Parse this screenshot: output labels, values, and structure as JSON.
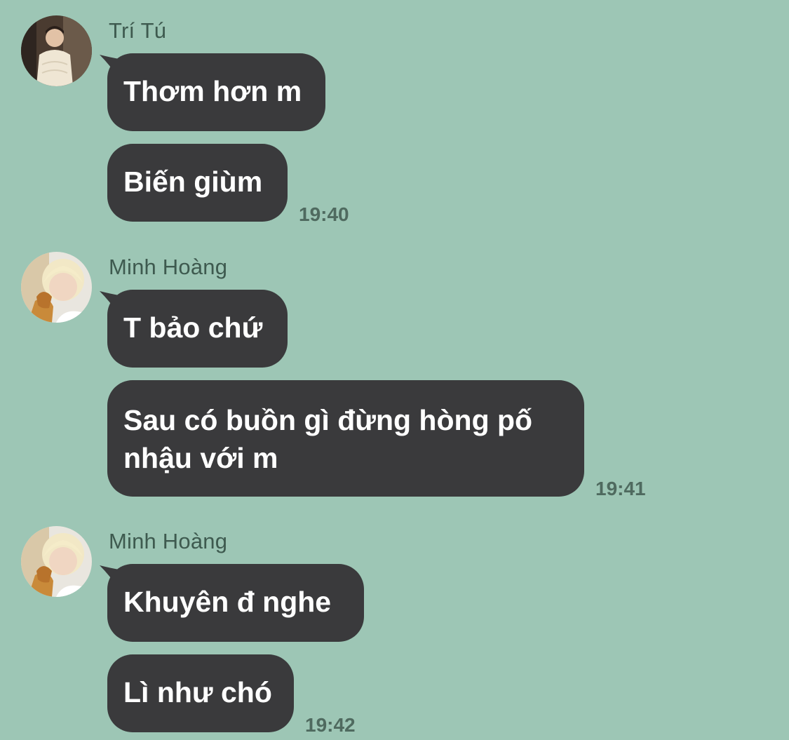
{
  "colors": {
    "background": "#9dc6b5",
    "bubble": "#3a3a3c",
    "bubble_text": "#ffffff",
    "sender_text": "#3e5a4f",
    "time_text": "#4f6a5f"
  },
  "messages": [
    {
      "sender": "Trí Tú",
      "avatar": "person-photo-icon",
      "bubbles": [
        "Thơm hơn m",
        "Biến giùm"
      ],
      "time": "19:40"
    },
    {
      "sender": "Minh Hoàng",
      "avatar": "person-photo-icon",
      "bubbles": [
        "T bảo chứ",
        "Sau có buồn gì đừng hòng pố nhậu với m"
      ],
      "time": "19:41"
    },
    {
      "sender": "Minh Hoàng",
      "avatar": "person-photo-icon",
      "bubbles": [
        "Khuyên đ nghe",
        "Lì như chó"
      ],
      "time": "19:42"
    }
  ]
}
